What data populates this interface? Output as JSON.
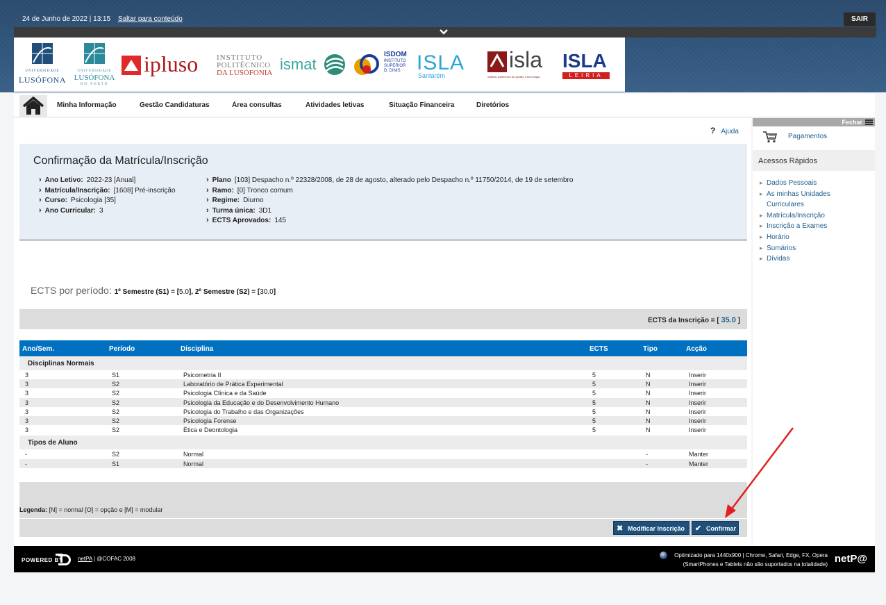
{
  "topbar": {
    "datetime": "24 de Junho de 2022 | 13:15",
    "skip_link": "Saltar para conteúdo",
    "logout": "SAIR"
  },
  "logos": {
    "lusofona": {
      "line1": "UNIVERSIDADE",
      "line2": "LUSÓFONA"
    },
    "lusofona_porto": {
      "line1": "UNIVERSIDADE",
      "line2": "LUSÓFONA",
      "line3": "DO PORTO"
    },
    "ipluso": "ipluso",
    "ipl": {
      "line1": "INSTITUTO",
      "line2": "POLITÉCNICO",
      "line3": "DA LUSÓFONIA"
    },
    "ismat": "ismat",
    "isdom": {
      "line1": "ISDOM",
      "line2": "INSTITUTO",
      "line3": "SUPERIOR",
      "line4": "D. DINIS"
    },
    "isla_santarem": {
      "name": "ISLA",
      "sub": "Santarém"
    },
    "isla": {
      "name": "isla",
      "sub": "instituto politécnico de gestão e tecnologia"
    },
    "isla_leiria": {
      "name": "ISLA",
      "sub": "LEIRIA"
    }
  },
  "nav": {
    "items": [
      "Minha Informação",
      "Gestão Candidaturas",
      "Área consultas",
      "Atividades letivas",
      "Situação Financeira",
      "Diretórios"
    ]
  },
  "help": {
    "label": "Ajuda"
  },
  "info": {
    "title": "Confirmação da Matrícula/Inscrição",
    "left": [
      {
        "label": "Ano Letivo:",
        "value": "2022-23 [Anual]"
      },
      {
        "label": "Matrícula/Inscrição:",
        "value": "[1608] Pré-inscrição"
      },
      {
        "label": "Curso:",
        "value": "Psicologia [35]"
      },
      {
        "label": "Ano Curricular:",
        "value": "3"
      }
    ],
    "right": [
      {
        "label": "Plano",
        "value": "[103] Despacho n.º 22328/2008, de 28 de agosto, alterado pelo Despacho n.º 11750/2014, de 19 de setembro"
      },
      {
        "label": "Ramo:",
        "value": "[0] Tronco comum"
      },
      {
        "label": "Regime:",
        "value": "Diurno"
      },
      {
        "label": "Turma única:",
        "value": "3D1"
      },
      {
        "label": "ECTS Aprovados:",
        "value": "145"
      }
    ]
  },
  "ects_periodo": {
    "label": "ECTS por período:",
    "s1_label": "1º Semestre (S1) = [",
    "s1_value": "5.0",
    "s2_label": "], 2º Semestre (S2) = [",
    "s2_value": "30.0",
    "close": "]"
  },
  "ects_inscricao": {
    "label": "ECTS da Inscrição = [",
    "value": "35.0",
    "close": "]"
  },
  "table": {
    "headers": [
      "Ano/Sem.",
      "Período",
      "Disciplina",
      "ECTS",
      "Tipo",
      "Acção"
    ],
    "groups": [
      {
        "title": "Disciplinas Normais",
        "rows": [
          [
            "3",
            "S1",
            "Psicometria II",
            "5",
            "N",
            "Inserir"
          ],
          [
            "3",
            "S2",
            "Laboratório de Prática Experimental",
            "5",
            "N",
            "Inserir"
          ],
          [
            "3",
            "S2",
            "Psicologia Clínica e da Saúde",
            "5",
            "N",
            "Inserir"
          ],
          [
            "3",
            "S2",
            "Psicologia da Educação e do Desenvolvimento Humano",
            "5",
            "N",
            "Inserir"
          ],
          [
            "3",
            "S2",
            "Psicologia do Trabalho e das Organizações",
            "5",
            "N",
            "Inserir"
          ],
          [
            "3",
            "S2",
            "Psicologia Forense",
            "5",
            "N",
            "Inserir"
          ],
          [
            "3",
            "S2",
            "Ética e Deontologia",
            "5",
            "N",
            "Inserir"
          ]
        ]
      },
      {
        "title": "Tipos de Aluno",
        "rows": [
          [
            "-",
            "S2",
            "Normal",
            "",
            "-",
            "Manter"
          ],
          [
            "-",
            "S1",
            "Normal",
            "",
            "-",
            "Manter"
          ]
        ]
      }
    ]
  },
  "legend": {
    "label": "Legenda:",
    "text": "[N] = normal [O] = opção e [M] = modular"
  },
  "buttons": {
    "modify": "Modificar Inscrição",
    "confirm": "Confirmar"
  },
  "sidebar": {
    "close": "Fechar",
    "payments": "Pagamentos",
    "quick_access_title": "Acessos Rápidos",
    "quick_access": [
      "Dados Pessoais",
      "As minhas Unidades Curriculares",
      "Matrícula/Inscrição",
      "Inscrição a Exames",
      "Horário",
      "Sumários",
      "Dívidas"
    ]
  },
  "footer": {
    "powered": "POWERED BY",
    "netpa": "netPA",
    "copyright": " | @COFAC 2008",
    "optimized": "Optimizado para 1440x900 | Chrome, Safari, Edge, FX, Opera",
    "mobile_note": "(SmartPhones e Tablets não são suportados na totalidade)",
    "logo": "netP@"
  },
  "colors": {
    "accent": "#0070c0",
    "button": "#1f4f7a",
    "info_bg": "#e8eef5",
    "annotation": "#e02020"
  }
}
